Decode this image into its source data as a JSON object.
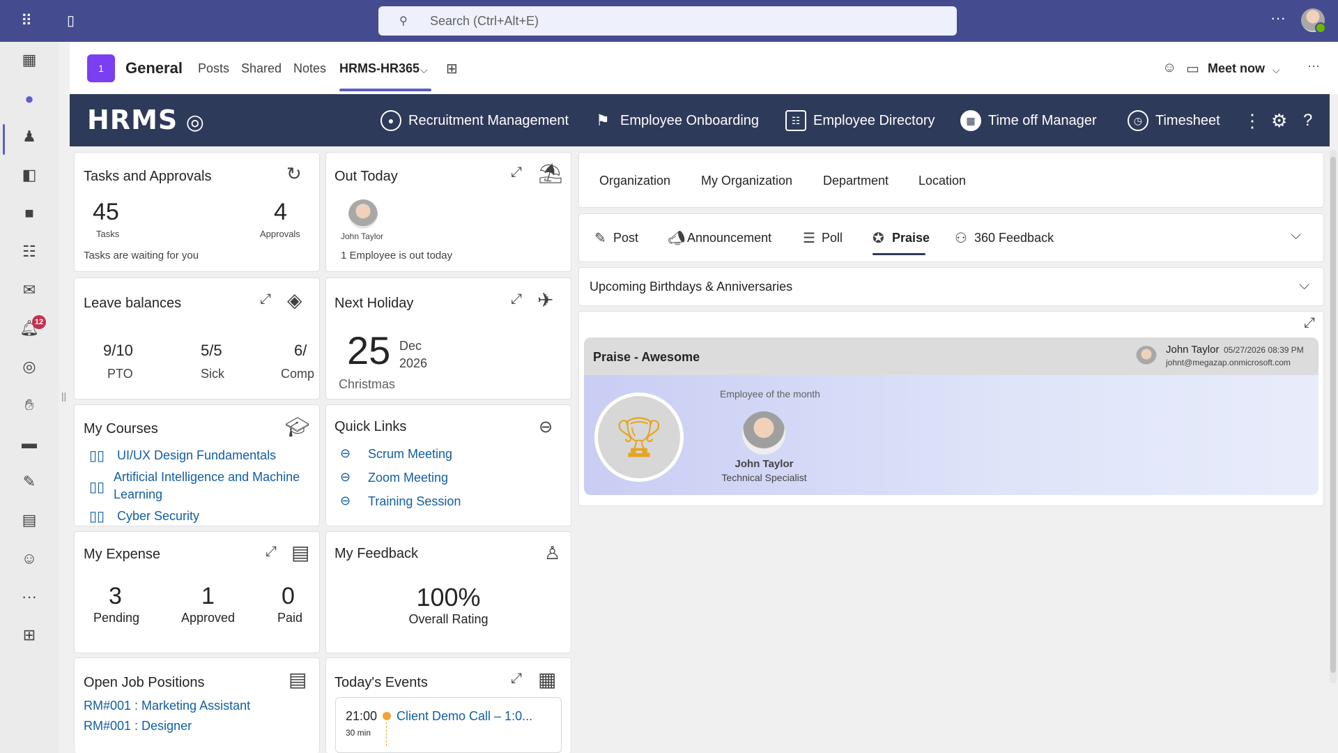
{
  "search": {
    "placeholder": "Search (Ctrl+Alt+E)"
  },
  "channel": {
    "avatar_text": "1",
    "title": "General",
    "tabs": [
      "Posts",
      "Shared",
      "Notes",
      "HRMS-HR365"
    ],
    "active_tab": "HRMS-HR365",
    "meet_now": "Meet now"
  },
  "rail": {
    "notification_count": "12"
  },
  "hrms": {
    "logo": "HRMS",
    "nav": [
      "Recruitment Management",
      "Employee Onboarding",
      "Employee Directory",
      "Time off Manager",
      "Timesheet"
    ]
  },
  "tasks": {
    "title": "Tasks and Approvals",
    "tasks_count": "45",
    "tasks_label": "Tasks",
    "approvals_count": "4",
    "approvals_label": "Approvals",
    "footer": "Tasks are waiting for you"
  },
  "out_today": {
    "title": "Out Today",
    "person": "John Taylor",
    "footer": "1 Employee is out today"
  },
  "leave": {
    "title": "Leave balances",
    "items": [
      {
        "value": "9/10",
        "label": "PTO"
      },
      {
        "value": "5/5",
        "label": "Sick"
      },
      {
        "value": "6/",
        "label": "Comp"
      }
    ]
  },
  "holiday": {
    "title": "Next Holiday",
    "day": "25",
    "month": "Dec",
    "year": "2026",
    "name": "Christmas"
  },
  "courses": {
    "title": "My Courses",
    "items": [
      "UI/UX Design Fundamentals",
      "Artificial Intelligence and Machine",
      "Learning",
      "Cyber Security"
    ]
  },
  "quicklinks": {
    "title": "Quick Links",
    "items": [
      "Scrum Meeting",
      "Zoom Meeting",
      "Training Session"
    ]
  },
  "expense": {
    "title": "My Expense",
    "items": [
      {
        "value": "3",
        "label": "Pending"
      },
      {
        "value": "1",
        "label": "Approved"
      },
      {
        "value": "0",
        "label": "Paid"
      }
    ]
  },
  "feedback": {
    "title": "My Feedback",
    "rating": "100%",
    "label": "Overall Rating"
  },
  "jobs": {
    "title": "Open Job Positions",
    "items": [
      "RM#001 : Marketing Assistant",
      "RM#001 : Designer"
    ]
  },
  "events": {
    "title": "Today's Events",
    "time": "21:00",
    "duration": "30 min",
    "name": "Client Demo Call – 1:0...",
    "dot_color": "#f2a33a"
  },
  "org_tabs": [
    "Organization",
    "My Organization",
    "Department",
    "Location"
  ],
  "post_tabs": [
    "Post",
    "Announcement",
    "Poll",
    "Praise",
    "360 Feedback"
  ],
  "active_post_tab": "Praise",
  "birthdays": {
    "title": "Upcoming Birthdays & Anniversaries"
  },
  "praise": {
    "title": "Praise - Awesome",
    "author": "John Taylor",
    "datetime": "05/27/2026 08:39 PM",
    "email": "johnt@megazap.onmicrosoft.com",
    "subtitle": "Employee of the month",
    "person": "John Taylor",
    "role": "Technical Specialist"
  },
  "colors": {
    "brand": "#454b8f",
    "hrms_bar": "#2e3a59",
    "accent": "#5b5fc7",
    "link": "#115ea3"
  }
}
